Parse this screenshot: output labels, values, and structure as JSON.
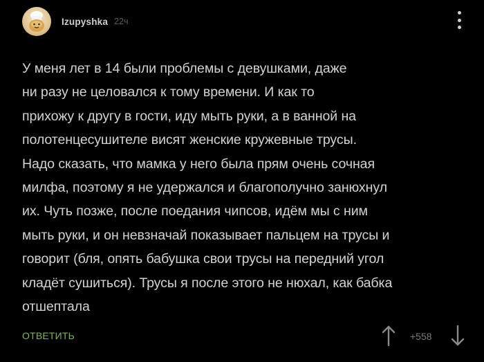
{
  "comment": {
    "author": "Izupyshka",
    "time": "22ч",
    "text": "У меня лет в 14 были проблемы с девушками, даже\nни разу не целовался к тому времени. И как то\nприхожу к другу в гости, иду мыть руки, а в ванной на\nполотенцесушителе висят женские кружевные трусы.\nНадо сказать, что мамка у него была прям очень сочная\nмилфа, поэтому я не удержался и благополучно занюхнул\nих. Чуть позже, после поедания чипсов, идём мы с ним\nмыть руки, и он невзначай показывает пальцем на трусы и\nговорит (бля, опять бабушка свои трусы на передний угол\nкладёт сушиться). Трусы я после этого не нюхал, как бабка\nотшептала",
    "reply_label": "ОТВЕТИТЬ",
    "rating": "+558"
  },
  "icons": {
    "avatar": "chef-cookie-avatar",
    "menu": "more-vertical-icon",
    "upvote": "arrow-up-icon",
    "downvote": "arrow-down-icon"
  },
  "colors": {
    "background": "#000000",
    "text": "#d2d2d2",
    "reply": "#7fb35a",
    "muted": "#7a7a7a"
  }
}
